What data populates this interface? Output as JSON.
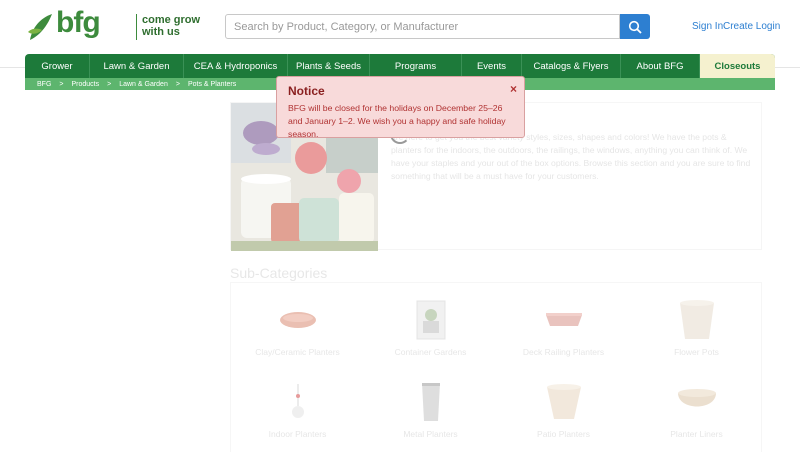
{
  "header": {
    "brand": "bfg",
    "tagline": "come grow with us",
    "search_placeholder": "Search by Product, Category, or Manufacturer",
    "sign_in": "Sign In",
    "create_login": "Create Login"
  },
  "nav": {
    "items": [
      {
        "label": "Grower"
      },
      {
        "label": "Lawn & Garden"
      },
      {
        "label": "CEA & Hydroponics"
      },
      {
        "label": "Plants & Seeds"
      },
      {
        "label": "Programs"
      },
      {
        "label": "Events"
      },
      {
        "label": "Catalogs & Flyers"
      },
      {
        "label": "About BFG"
      },
      {
        "label": "Closeouts"
      }
    ]
  },
  "breadcrumb": {
    "items": [
      "BFG",
      ">",
      "Products",
      ">",
      "Lawn & Garden",
      ">",
      "Pots & Planters"
    ]
  },
  "hero": {
    "description": "are here to get you the best variety styles, sizes, shapes and colors! We have the pots & planters for the indoors, the outdoors, the railings, the windows, anything you can think of. We have your staples and your out of the box options. Browse this section and you are sure to find something that will be a must have for your customers."
  },
  "subcategories": {
    "heading": "Sub-Categories",
    "items": [
      {
        "label": "Clay/Ceramic Planters"
      },
      {
        "label": "Container Gardens"
      },
      {
        "label": "Deck Railing Planters"
      },
      {
        "label": "Flower Pots"
      },
      {
        "label": "Indoor Planters"
      },
      {
        "label": "Metal Planters"
      },
      {
        "label": "Patio Planters"
      },
      {
        "label": "Planter Liners"
      }
    ]
  },
  "notice": {
    "title": "Notice",
    "message": "BFG will be closed for the holidays on December 25–26 and January 1–2. We wish you a happy and safe holiday season.",
    "close_glyph": "×"
  },
  "colors": {
    "nav_green": "#1d7a3a",
    "crumb_green": "#5db56e",
    "accent_blue": "#2d7fd1",
    "notice_bg": "#f8dada",
    "notice_text": "#b03232"
  }
}
